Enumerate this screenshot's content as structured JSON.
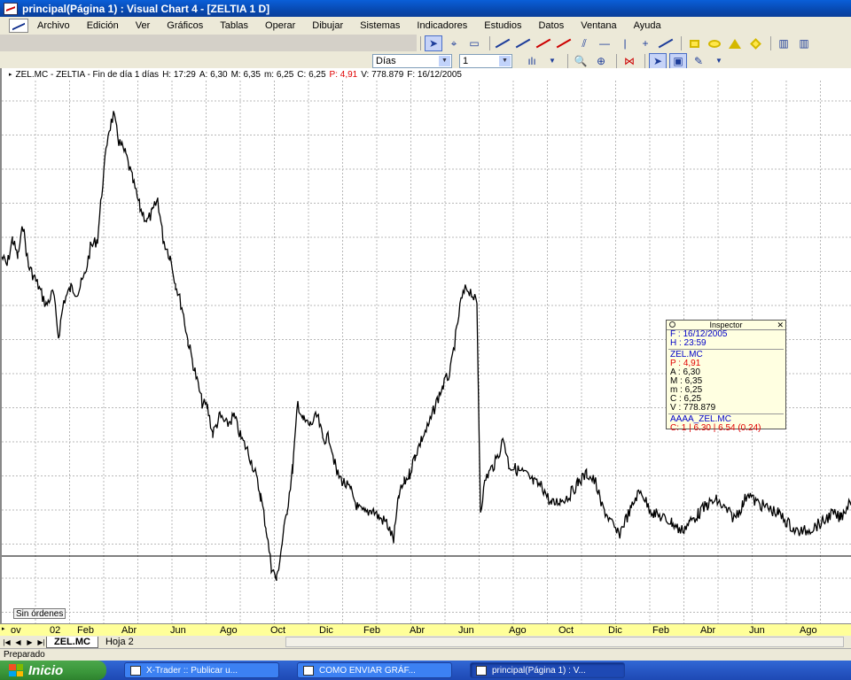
{
  "window": {
    "title": "principal(Página 1) : Visual Chart 4 - [ZELTIA 1 D]"
  },
  "menu": {
    "items": [
      "Archivo",
      "Edición",
      "Ver",
      "Gráficos",
      "Tablas",
      "Operar",
      "Dibujar",
      "Sistemas",
      "Indicadores",
      "Estudios",
      "Datos",
      "Ventana",
      "Ayuda"
    ]
  },
  "toolbar": {
    "period": "Días",
    "multiplier": "1"
  },
  "infobar": {
    "symbol": "ZEL.MC - ZELTIA - Fin de día 1 días",
    "h": "H: 17:29",
    "a": "A: 6,30",
    "m": "M: 6,35",
    "min": "m: 6,25",
    "c": "C: 6,25",
    "p": "P: 4,91",
    "v": "V: 778.879",
    "f": "F: 16/12/2005"
  },
  "inspector": {
    "title": "Inspector",
    "f": "F : 16/12/2005",
    "h": "H : 23:59",
    "symbol": "ZEL.MC",
    "p": "P : 4,91",
    "a": "A : 6,30",
    "m": "M : 6,35",
    "min": "m : 6,25",
    "c": "C : 6,25",
    "v": "V : 778.879",
    "indicator": "AAAA_ZEL.MC",
    "indicator_value": "C: 1 | 6.30 | 6.54 (0.24)"
  },
  "orders_badge": "Sin órdenes",
  "x_axis": {
    "labels": [
      "ov",
      "02",
      "Feb",
      "Abr",
      "Jun",
      "Ago",
      "Oct",
      "Dic",
      "Feb",
      "Abr",
      "Jun",
      "Ago",
      "Oct",
      "Dic",
      "Feb",
      "Abr",
      "Jun",
      "Ago"
    ]
  },
  "sheets": {
    "tabs": [
      "ZEL.MC",
      "Hoja 2"
    ]
  },
  "status": {
    "text": "Preparado"
  },
  "taskbar": {
    "start": "Inicio",
    "tasks": [
      "X-Trader :: Publicar u...",
      "COMO ENVIAR GRÁF...",
      "principal(Página 1) : V..."
    ]
  },
  "chart_data": {
    "type": "line",
    "series_anchors": [
      [
        0,
        290
      ],
      [
        6,
        300
      ],
      [
        12,
        270
      ],
      [
        18,
        290
      ],
      [
        24,
        255
      ],
      [
        30,
        300
      ],
      [
        40,
        320
      ],
      [
        50,
        345
      ],
      [
        58,
        330
      ],
      [
        64,
        380
      ],
      [
        70,
        340
      ],
      [
        78,
        325
      ],
      [
        86,
        330
      ],
      [
        94,
        310
      ],
      [
        100,
        280
      ],
      [
        108,
        270
      ],
      [
        114,
        205
      ],
      [
        120,
        150
      ],
      [
        126,
        130
      ],
      [
        132,
        160
      ],
      [
        140,
        175
      ],
      [
        148,
        205
      ],
      [
        156,
        235
      ],
      [
        164,
        250
      ],
      [
        170,
        240
      ],
      [
        176,
        225
      ],
      [
        182,
        270
      ],
      [
        190,
        290
      ],
      [
        196,
        320
      ],
      [
        204,
        350
      ],
      [
        210,
        385
      ],
      [
        218,
        420
      ],
      [
        226,
        455
      ],
      [
        232,
        460
      ],
      [
        238,
        490
      ],
      [
        246,
        470
      ],
      [
        254,
        480
      ],
      [
        262,
        470
      ],
      [
        270,
        495
      ],
      [
        278,
        510
      ],
      [
        286,
        535
      ],
      [
        292,
        560
      ],
      [
        298,
        595
      ],
      [
        304,
        640
      ],
      [
        310,
        655
      ],
      [
        316,
        615
      ],
      [
        322,
        575
      ],
      [
        328,
        530
      ],
      [
        334,
        455
      ],
      [
        340,
        475
      ],
      [
        348,
        480
      ],
      [
        356,
        470
      ],
      [
        362,
        495
      ],
      [
        370,
        495
      ],
      [
        378,
        535
      ],
      [
        386,
        545
      ],
      [
        394,
        555
      ],
      [
        402,
        575
      ],
      [
        410,
        580
      ],
      [
        418,
        575
      ],
      [
        426,
        585
      ],
      [
        434,
        590
      ],
      [
        442,
        610
      ],
      [
        448,
        560
      ],
      [
        454,
        545
      ],
      [
        460,
        535
      ],
      [
        466,
        515
      ],
      [
        474,
        495
      ],
      [
        482,
        480
      ],
      [
        490,
        455
      ],
      [
        498,
        435
      ],
      [
        506,
        420
      ],
      [
        512,
        380
      ],
      [
        518,
        340
      ],
      [
        524,
        325
      ],
      [
        530,
        330
      ],
      [
        536,
        345
      ],
      [
        540,
        575
      ],
      [
        546,
        540
      ],
      [
        552,
        530
      ],
      [
        558,
        520
      ],
      [
        566,
        495
      ],
      [
        572,
        525
      ],
      [
        580,
        530
      ],
      [
        590,
        535
      ],
      [
        600,
        545
      ],
      [
        610,
        550
      ],
      [
        620,
        570
      ],
      [
        630,
        565
      ],
      [
        640,
        560
      ],
      [
        650,
        545
      ],
      [
        660,
        535
      ],
      [
        670,
        545
      ],
      [
        676,
        570
      ],
      [
        682,
        580
      ],
      [
        690,
        595
      ],
      [
        696,
        605
      ],
      [
        702,
        590
      ],
      [
        710,
        575
      ],
      [
        716,
        560
      ],
      [
        722,
        555
      ],
      [
        728,
        570
      ],
      [
        736,
        580
      ],
      [
        746,
        585
      ],
      [
        756,
        590
      ],
      [
        766,
        600
      ],
      [
        776,
        590
      ],
      [
        786,
        580
      ],
      [
        796,
        570
      ],
      [
        806,
        565
      ],
      [
        816,
        575
      ],
      [
        826,
        585
      ],
      [
        836,
        570
      ],
      [
        842,
        555
      ],
      [
        848,
        565
      ],
      [
        856,
        570
      ],
      [
        866,
        575
      ],
      [
        876,
        580
      ],
      [
        886,
        590
      ],
      [
        896,
        600
      ],
      [
        906,
        600
      ],
      [
        916,
        595
      ],
      [
        926,
        590
      ],
      [
        936,
        580
      ],
      [
        946,
        585
      ],
      [
        960,
        560
      ]
    ]
  }
}
